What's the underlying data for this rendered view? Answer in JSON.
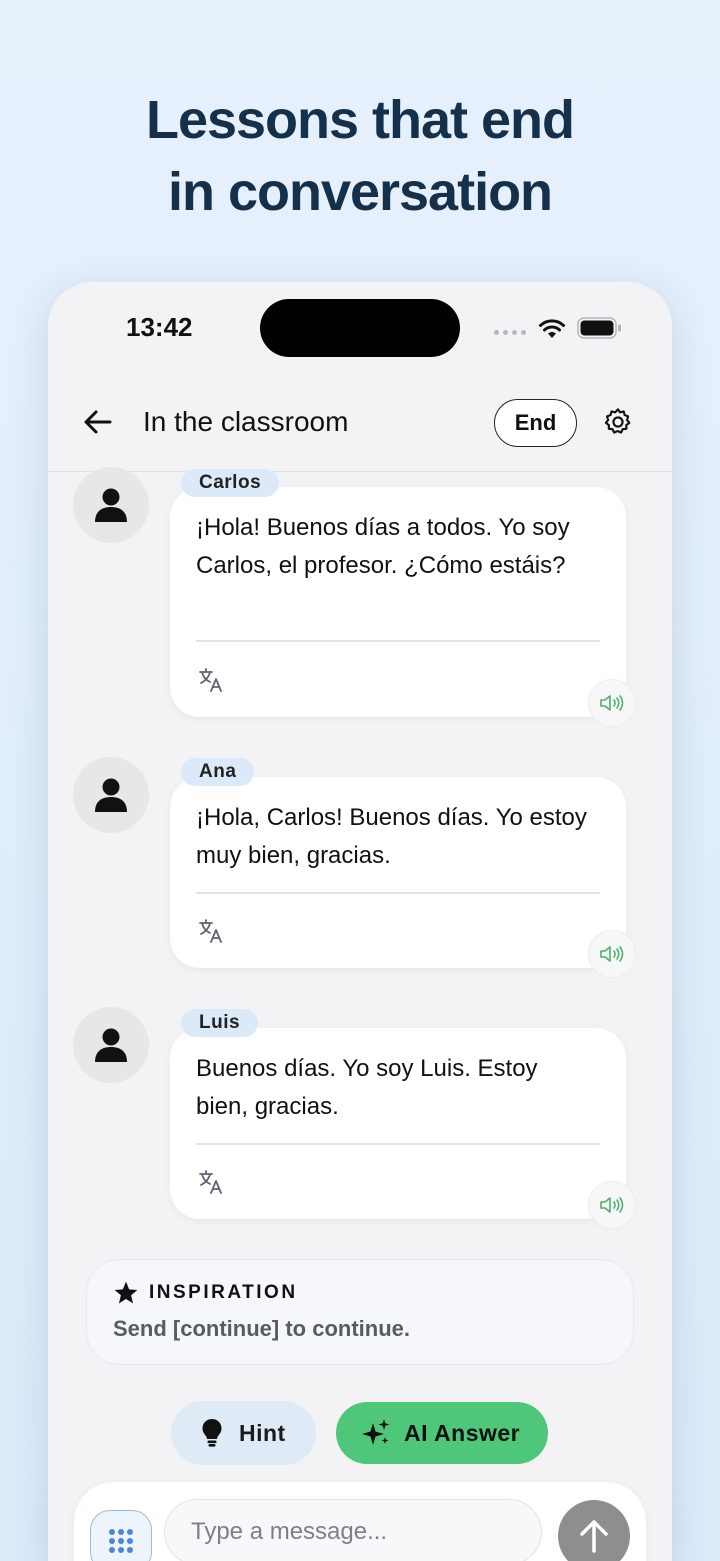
{
  "headline": {
    "line1": "Lessons that end",
    "line2": "in conversation"
  },
  "status_bar": {
    "time": "13:42",
    "icons": [
      "signal-icon",
      "wifi-icon",
      "battery-icon"
    ]
  },
  "header": {
    "title": "In the classroom",
    "end_label": "End",
    "icons": [
      "back-arrow-icon",
      "gear-icon"
    ]
  },
  "messages": [
    {
      "speaker": "Carlos",
      "text": "¡Hola! Buenos días a todos. Yo soy Carlos, el profesor. ¿Cómo estáis?"
    },
    {
      "speaker": "Ana",
      "text": "¡Hola, Carlos! Buenos días. Yo estoy muy bien, gracias."
    },
    {
      "speaker": "Luis",
      "text": "Buenos días. Yo soy Luis. Estoy bien, gracias."
    }
  ],
  "inspiration": {
    "label": "INSPIRATION",
    "text": "Send [continue] to continue."
  },
  "actions": {
    "hint_label": "Hint",
    "ai_answer_label": "AI Answer"
  },
  "composer": {
    "placeholder": "Type a message..."
  },
  "colors": {
    "background": "#e6f1fc",
    "headline": "#15304b",
    "name_tag": "#dbe9f8",
    "ai_button": "#4fc77a",
    "speaker_icon": "#4caf6e",
    "send_button": "#8e8e8e"
  }
}
